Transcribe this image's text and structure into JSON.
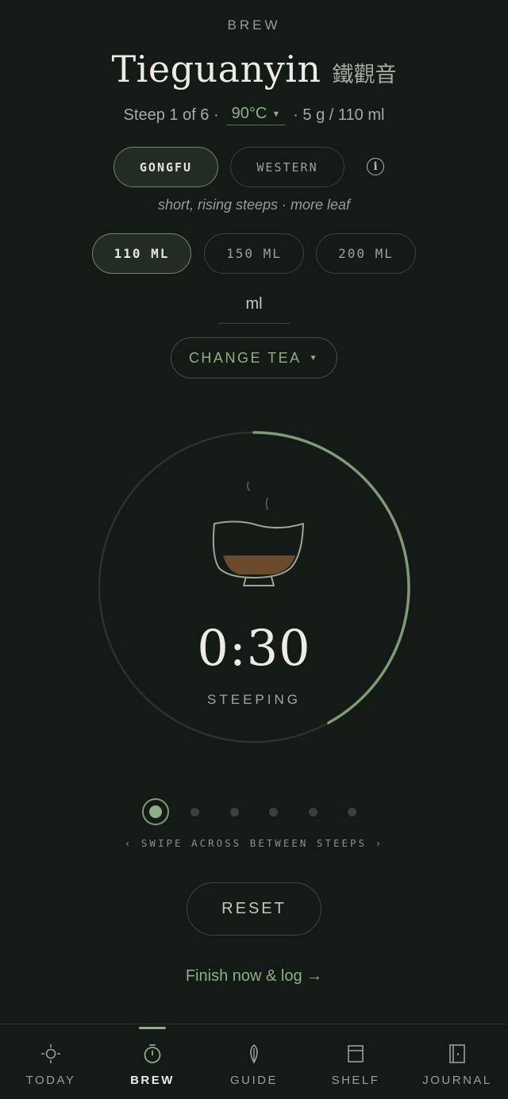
{
  "header": {
    "eyebrow": "BREW",
    "tea_name": "Tieguanyin",
    "tea_name_native": "鐵觀音",
    "steep_text": "Steep 1 of 6 ·",
    "temperature": "90°C",
    "dose_text": "· 5 g / 110 ml"
  },
  "brew_style": {
    "options": [
      "GONGFU",
      "WESTERN"
    ],
    "selected": "GONGFU",
    "hint": "short, rising steeps · more leaf"
  },
  "vessel": {
    "options": [
      "110 ML",
      "150 ML",
      "200 ML"
    ],
    "selected": "110 ML",
    "custom_unit": "ml"
  },
  "change_tea_label": "CHANGE TEA",
  "timer": {
    "time": "0:30",
    "status": "STEEPING",
    "progress": 0.42
  },
  "steeps": {
    "total": 6,
    "current": 1,
    "hint": "‹ SWIPE ACROSS BETWEEN STEEPS ›"
  },
  "actions": {
    "reset_label": "RESET",
    "finish_label": "Finish now & log →"
  },
  "tabs": [
    {
      "label": "TODAY",
      "icon": "sun-icon"
    },
    {
      "label": "BREW",
      "icon": "timer-icon"
    },
    {
      "label": "GUIDE",
      "icon": "leaf-icon"
    },
    {
      "label": "SHELF",
      "icon": "shelf-icon"
    },
    {
      "label": "JOURNAL",
      "icon": "journal-icon"
    }
  ],
  "active_tab": "BREW",
  "colors": {
    "background": "#141a16",
    "accent": "#8fae84",
    "tea_liquor": "#6b4a2c"
  }
}
